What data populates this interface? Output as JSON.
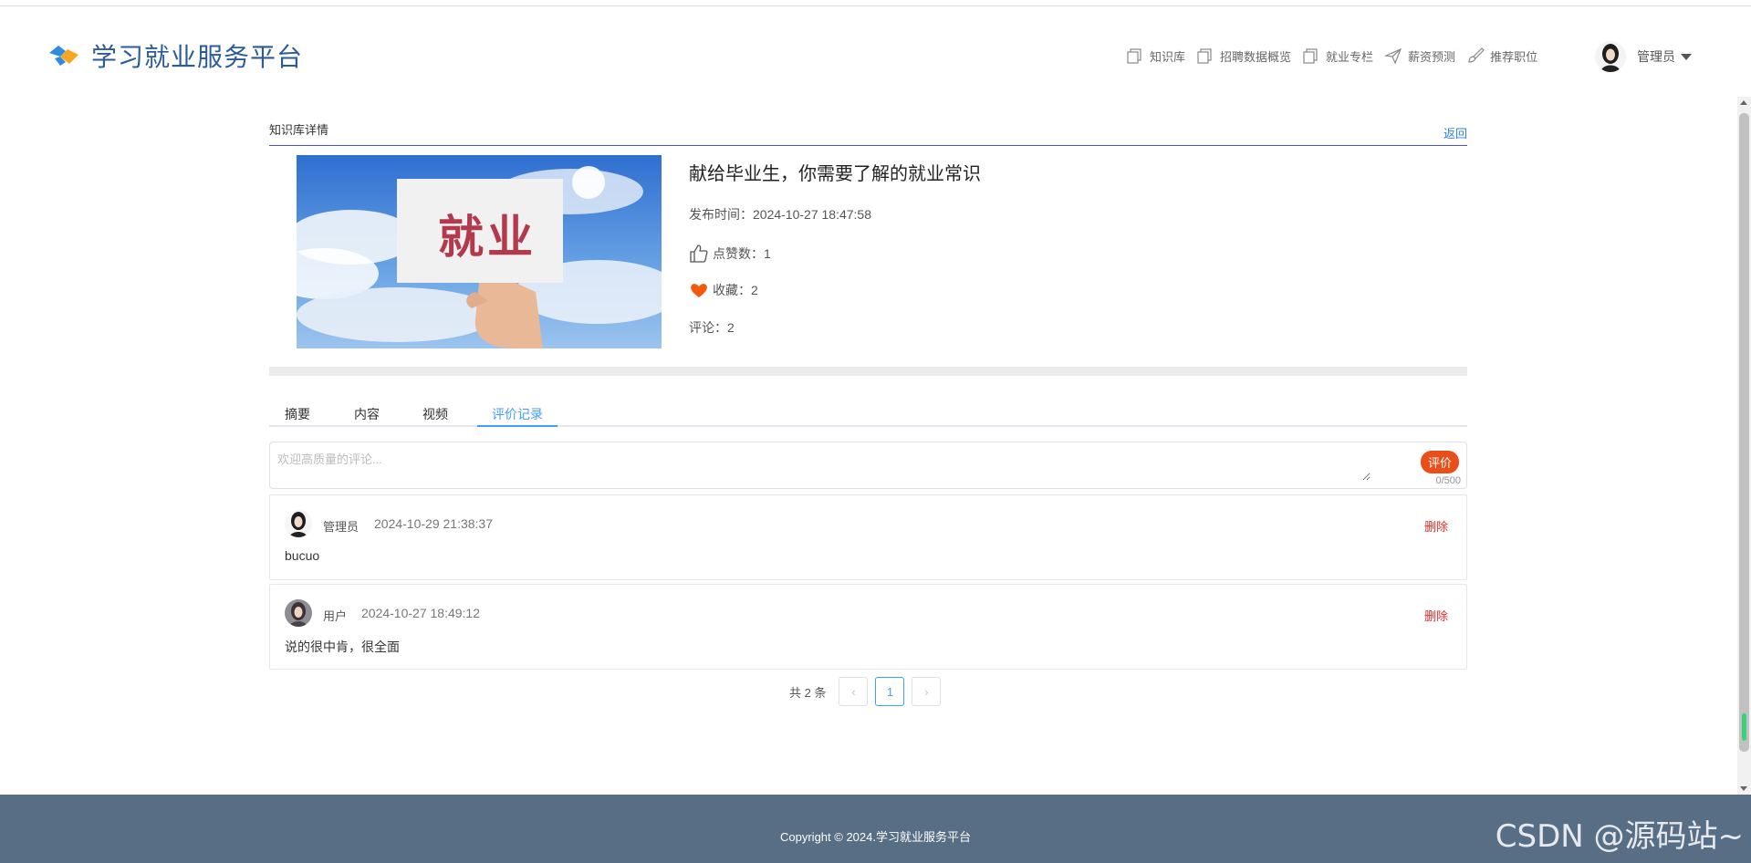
{
  "header": {
    "logo_text": "学习就业服务平台",
    "nav": [
      {
        "label": "知识库",
        "icon": "copy-icon"
      },
      {
        "label": "招聘数据概览",
        "icon": "copy-icon"
      },
      {
        "label": "就业专栏",
        "icon": "copy-icon"
      },
      {
        "label": "薪资预测",
        "icon": "paper-plane-icon"
      },
      {
        "label": "推荐职位",
        "icon": "brush-icon"
      }
    ],
    "user": "管理员"
  },
  "section": {
    "title": "知识库详情",
    "back": "返回"
  },
  "article": {
    "cover_text": "就业",
    "title": "献给毕业生，你需要了解的就业常识",
    "publish_label": "发布时间：",
    "publish_time": "2024-10-27 18:47:58",
    "likes_label": "点赞数：",
    "likes": "1",
    "favorites_label": "收藏：",
    "favorites": "2",
    "comments_label": "评论：",
    "comments": "2"
  },
  "tabs": [
    "摘要",
    "内容",
    "视频",
    "评价记录"
  ],
  "comment_box": {
    "placeholder": "欢迎高质量的评论...",
    "counter": "0/500",
    "submit": "评价"
  },
  "comments": [
    {
      "user": "管理员",
      "time": "2024-10-29 21:38:37",
      "text": "bucuo",
      "delete": "删除"
    },
    {
      "user": "用户",
      "time": "2024-10-27 18:49:12",
      "text": "说的很中肯，很全面",
      "delete": "删除"
    }
  ],
  "pager": {
    "total": "共 2 条",
    "prev": "‹",
    "current": "1",
    "next": "›"
  },
  "footer": {
    "copyright": "Copyright © 2024.学习就业服务平台",
    "watermark": "CSDN @源码站~"
  },
  "colors": {
    "accent": "#409eff",
    "brand_blue": "#2a5b9a",
    "danger": "#f02b2b",
    "rate_button": "#e94e1b",
    "footer_bg": "#586e85"
  }
}
